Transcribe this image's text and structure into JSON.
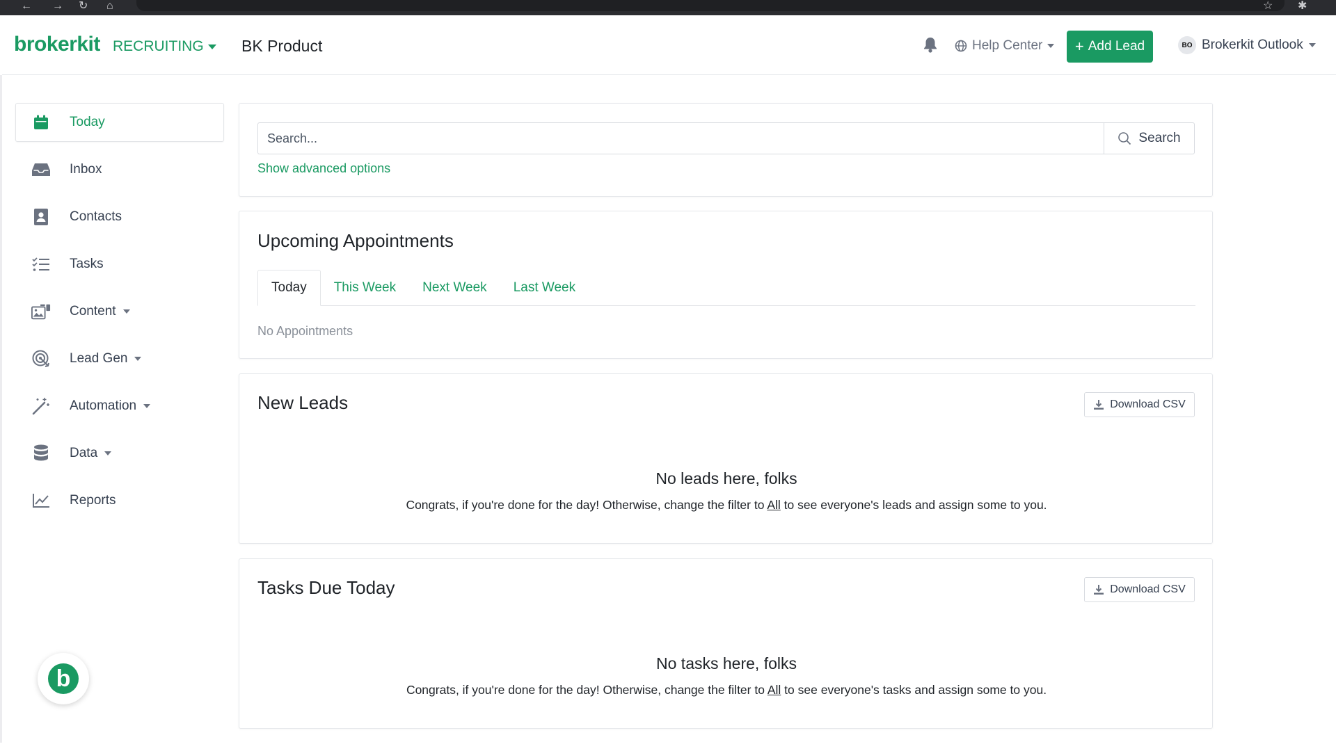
{
  "header": {
    "logo": "brokerkit",
    "workspace": "RECRUITING",
    "product": "BK Product",
    "help_center": "Help Center",
    "add_lead": "Add Lead",
    "user_initials": "BO",
    "user_name": "Brokerkit Outlook"
  },
  "sidebar": {
    "items": [
      {
        "label": "Today",
        "icon": "calendar-icon",
        "active": true
      },
      {
        "label": "Inbox",
        "icon": "inbox-icon"
      },
      {
        "label": "Contacts",
        "icon": "contacts-icon"
      },
      {
        "label": "Tasks",
        "icon": "tasks-icon"
      },
      {
        "label": "Content",
        "icon": "content-icon",
        "dropdown": true
      },
      {
        "label": "Lead Gen",
        "icon": "lead-gen-icon",
        "dropdown": true
      },
      {
        "label": "Automation",
        "icon": "magic-wand-icon",
        "dropdown": true
      },
      {
        "label": "Data",
        "icon": "database-icon",
        "dropdown": true
      },
      {
        "label": "Reports",
        "icon": "chart-icon"
      }
    ],
    "widget_letter": "b"
  },
  "search": {
    "placeholder": "Search...",
    "button": "Search",
    "advanced": "Show advanced options"
  },
  "appointments": {
    "title": "Upcoming Appointments",
    "tabs": [
      "Today",
      "This Week",
      "Next Week",
      "Last Week"
    ],
    "empty": "No Appointments"
  },
  "new_leads": {
    "title": "New Leads",
    "download": "Download CSV",
    "empty_title": "No leads here, folks",
    "empty_before": "Congrats, if you're done for the day! Otherwise, change the filter to ",
    "empty_link": "All",
    "empty_after": " to see everyone's leads and assign some to you."
  },
  "tasks_due": {
    "title": "Tasks Due Today",
    "download": "Download CSV",
    "empty_title": "No tasks here, folks",
    "empty_before": "Congrats, if you're done for the day! Otherwise, change the filter to ",
    "empty_link": "All",
    "empty_after": " to see everyone's tasks and assign some to you."
  },
  "colors": {
    "accent": "#1a9a62",
    "muted": "#6b7280"
  }
}
